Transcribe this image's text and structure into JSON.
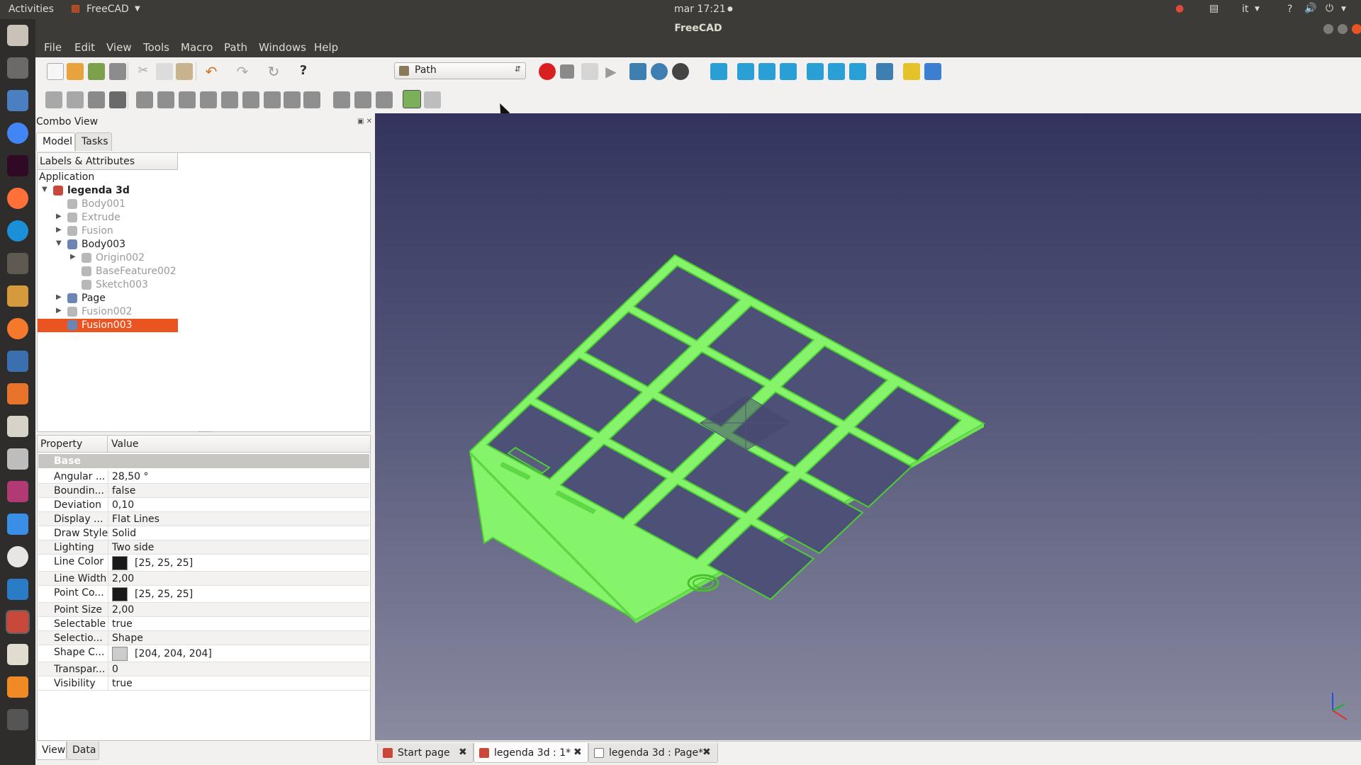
{
  "topbar": {
    "activities": "Activities",
    "app_menu": "FreeCAD",
    "clock": "mar 17:21",
    "lang": "it",
    "help": "?"
  },
  "window": {
    "title": "FreeCAD"
  },
  "menu": [
    "File",
    "Edit",
    "View",
    "Tools",
    "Macro",
    "Path",
    "Windows",
    "Help"
  ],
  "workbench": {
    "selected": "Path"
  },
  "combo": {
    "title": "Combo View",
    "tabs": [
      "Model",
      "Tasks"
    ],
    "bottom_tabs": [
      "View",
      "Data"
    ],
    "tree_header": "Labels & Attributes",
    "tree_root": "Application",
    "tree": [
      {
        "label": "legenda 3d",
        "level": 0,
        "expander": "open",
        "bold": true,
        "dim": false
      },
      {
        "label": "Body001",
        "level": 1,
        "expander": "none",
        "dim": true
      },
      {
        "label": "Extrude",
        "level": 1,
        "expander": "closed",
        "dim": true
      },
      {
        "label": "Fusion",
        "level": 1,
        "expander": "closed",
        "dim": true
      },
      {
        "label": "Body003",
        "level": 1,
        "expander": "open",
        "dim": false
      },
      {
        "label": "Origin002",
        "level": 2,
        "expander": "closed",
        "dim": true
      },
      {
        "label": "BaseFeature002",
        "level": 2,
        "expander": "none",
        "dim": true
      },
      {
        "label": "Sketch003",
        "level": 2,
        "expander": "none",
        "dim": true
      },
      {
        "label": "Page",
        "level": 1,
        "expander": "closed",
        "dim": false
      },
      {
        "label": "Fusion002",
        "level": 1,
        "expander": "closed",
        "dim": true
      },
      {
        "label": "Fusion003",
        "level": 1,
        "expander": "none",
        "dim": false,
        "selected": true
      }
    ]
  },
  "props": {
    "col_property": "Property",
    "col_value": "Value",
    "group": "Base",
    "rows": [
      {
        "name": "Angular ...",
        "value": "28,50 °"
      },
      {
        "name": "Boundin...",
        "value": "false"
      },
      {
        "name": "Deviation",
        "value": "0,10"
      },
      {
        "name": "Display ...",
        "value": "Flat Lines"
      },
      {
        "name": "Draw Style",
        "value": "Solid"
      },
      {
        "name": "Lighting",
        "value": "Two side"
      },
      {
        "name": "Line Color",
        "value": "[25, 25, 25]",
        "swatch": "#191919"
      },
      {
        "name": "Line Width",
        "value": "2,00"
      },
      {
        "name": "Point Co...",
        "value": "[25, 25, 25]",
        "swatch": "#191919"
      },
      {
        "name": "Point Size",
        "value": "2,00"
      },
      {
        "name": "Selectable",
        "value": "true"
      },
      {
        "name": "Selectio...",
        "value": "Shape"
      },
      {
        "name": "Shape C...",
        "value": "[204, 204, 204]",
        "swatch": "#cccccc"
      },
      {
        "name": "Transpar...",
        "value": "0"
      },
      {
        "name": "Visibility",
        "value": "true"
      }
    ]
  },
  "doc_tabs": [
    {
      "label": "Start page",
      "active": false
    },
    {
      "label": "legenda 3d : 1*",
      "active": true
    },
    {
      "label": "legenda 3d : Page*",
      "active": false
    }
  ],
  "colors": {
    "accent": "#e95420",
    "model_fill": "#86f46a",
    "model_edge": "#4ccd34"
  }
}
